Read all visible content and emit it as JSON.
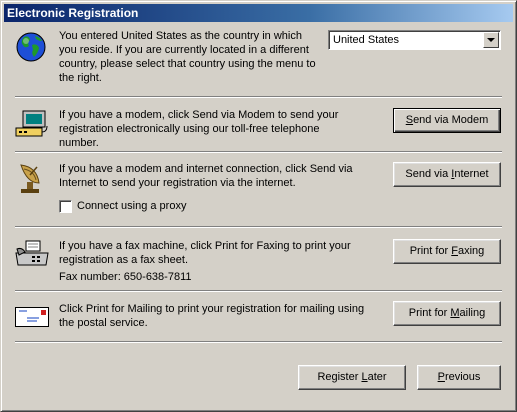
{
  "window": {
    "title": "Electronic Registration"
  },
  "country": {
    "text": "You entered United States as the country in which you reside.  If you are currently located in a different country, please select that country using the menu to the right.",
    "selected": "United States"
  },
  "modem": {
    "text": "If you have a modem, click Send via Modem to send your registration electronically using our toll-free telephone number.",
    "button": {
      "before": "",
      "key": "S",
      "after": "end via Modem"
    }
  },
  "internet": {
    "text": "If you have a modem and internet connection, click Send via Internet to send your registration via the internet.",
    "button": {
      "before": "Send via ",
      "key": "I",
      "after": "nternet"
    },
    "proxy_label": "Connect using a proxy"
  },
  "fax": {
    "text": "If you have a fax machine, click Print for Faxing to print your registration as a fax sheet.",
    "number": "Fax number: 650-638-7811",
    "button": {
      "before": "Print for ",
      "key": "F",
      "after": "axing"
    }
  },
  "mail": {
    "text": "Click Print for Mailing to print your registration for mailing using the postal service.",
    "button": {
      "before": "Print for ",
      "key": "M",
      "after": "ailing"
    }
  },
  "footer": {
    "register_later": {
      "before": "Register ",
      "key": "L",
      "after": "ater"
    },
    "previous": {
      "before": "",
      "key": "P",
      "after": "revious"
    }
  },
  "colors": {
    "title_start": "#0a246a",
    "title_end": "#a6caf0",
    "face": "#d4d0c8"
  },
  "icons": [
    "globe-icon",
    "modem-computer-icon",
    "satellite-dish-icon",
    "fax-machine-icon",
    "envelope-icon",
    "dropdown-arrow-icon"
  ]
}
